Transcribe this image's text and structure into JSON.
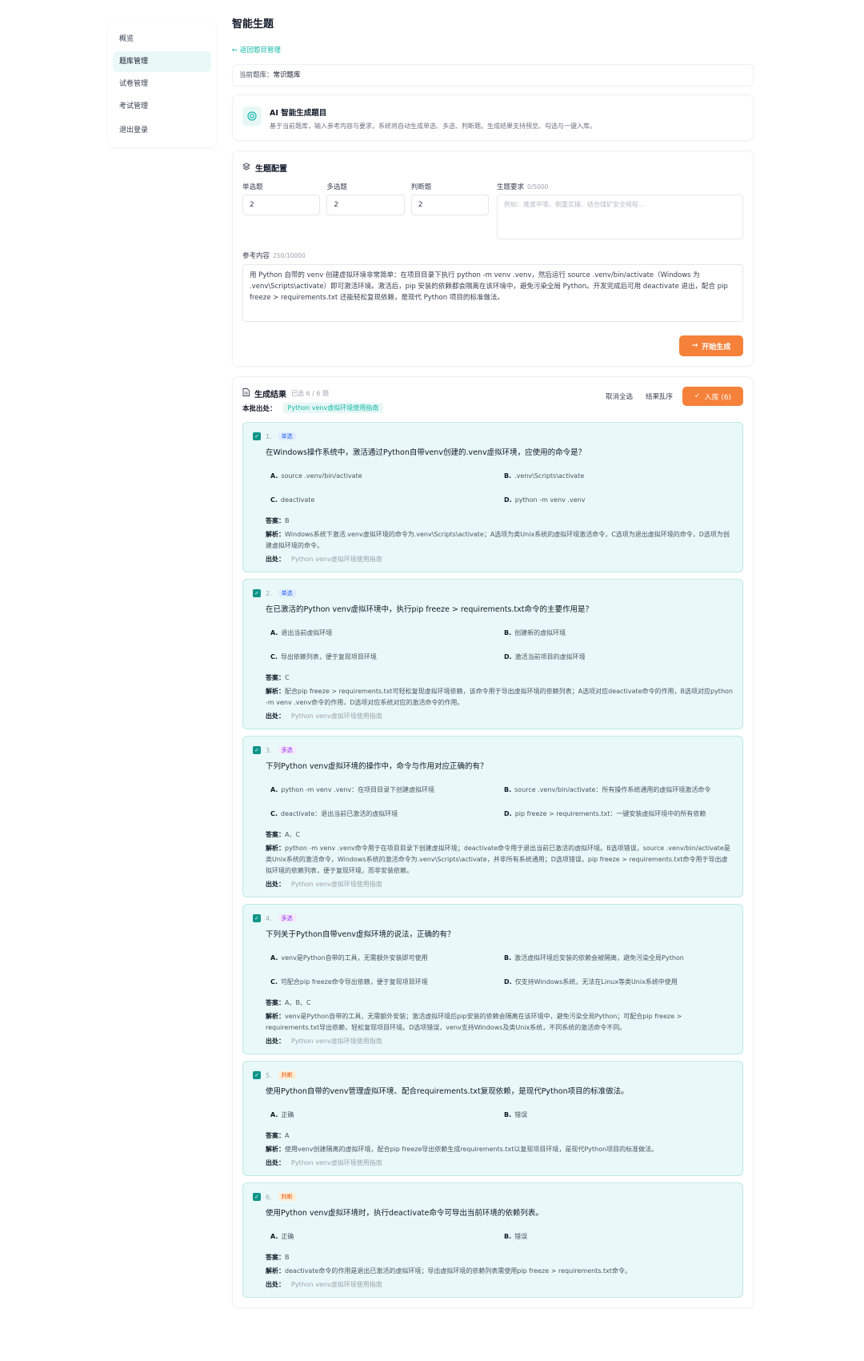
{
  "sidebar": {
    "items": [
      {
        "label": "概览"
      },
      {
        "label": "题库管理"
      },
      {
        "label": "试卷管理"
      },
      {
        "label": "考试管理"
      },
      {
        "label": "退出登录"
      }
    ]
  },
  "header": {
    "title": "智能生题",
    "back": "← 返回题目管理"
  },
  "bank": {
    "label": "当前题库：",
    "value": "常识题库"
  },
  "ai": {
    "title": "AI 智能生成题目",
    "desc": "基于当前题库，输入参考内容与要求，系统将自动生成单选、多选、判断题。生成结果支持预览、勾选与一键入库。"
  },
  "config": {
    "title": "生题配置",
    "single_label": "单选题",
    "single_value": "2",
    "multi_label": "多选题",
    "multi_value": "2",
    "judge_label": "判断题",
    "judge_value": "2",
    "req_label": "生题要求",
    "req_count": "0/5000",
    "req_placeholder": "例如：难度中等、侧重实操、结合煤矿安全规程...",
    "ref_label": "参考内容",
    "ref_count": "250/10000",
    "ref_text": "用 Python 自带的 venv 创建虚拟环境非常简单：在项目目录下执行 python -m venv .venv，然后运行 source .venv/bin/activate（Windows 为 .venv\\Scripts\\activate）即可激活环境。激活后，pip 安装的依赖都会隔离在该环境中，避免污染全局 Python。开发完成后可用 deactivate 退出，配合 pip freeze > requirements.txt 还能轻松复现依赖，是现代 Python 项目的标准做法。",
    "generate_btn": "开始生成"
  },
  "result": {
    "title": "生成结果",
    "selected": "已选 6 / 6 题",
    "source_label": "本批出处：",
    "source_tag": "Python venv虚拟环境使用指南",
    "deselect_all": "取消全选",
    "shuffle": "结果乱序",
    "import_btn": "入库 (6)"
  },
  "questions": [
    {
      "num": "1.",
      "type": "单选",
      "type_class": "single",
      "stem": "在Windows操作系统中，激活通过Python自带venv创建的.venv虚拟环境，应使用的命令是？",
      "options": [
        {
          "key": "A.",
          "text": "source .venv/bin/activate"
        },
        {
          "key": "B.",
          "text": ".venv\\Scripts\\activate"
        },
        {
          "key": "C.",
          "text": "deactivate"
        },
        {
          "key": "D.",
          "text": "python -m venv .venv"
        }
      ],
      "answer_label": "答案：",
      "answer": "B",
      "analysis_label": "解析：",
      "analysis": "Windows系统下激活.venv虚拟环境的命令为.venv\\Scripts\\activate；A选项为类Unix系统的虚拟环境激活命令，C选项为退出虚拟环境的命令，D选项为创建虚拟环境的命令。",
      "source_label": "出处：",
      "source": "Python venv虚拟环境使用指南"
    },
    {
      "num": "2.",
      "type": "单选",
      "type_class": "single",
      "stem": "在已激活的Python venv虚拟环境中，执行pip freeze > requirements.txt命令的主要作用是？",
      "options": [
        {
          "key": "A.",
          "text": "退出当前虚拟环境"
        },
        {
          "key": "B.",
          "text": "创建新的虚拟环境"
        },
        {
          "key": "C.",
          "text": "导出依赖列表，便于复现项目环境"
        },
        {
          "key": "D.",
          "text": "激活当前项目的虚拟环境"
        }
      ],
      "answer_label": "答案：",
      "answer": "C",
      "analysis_label": "解析：",
      "analysis": "配合pip freeze > requirements.txt可轻松复现虚拟环境依赖，该命令用于导出虚拟环境的依赖列表；A选项对应deactivate命令的作用，B选项对应python -m venv .venv命令的作用，D选项对应系统对应的激活命令的作用。",
      "source_label": "出处：",
      "source": "Python venv虚拟环境使用指南"
    },
    {
      "num": "3.",
      "type": "多选",
      "type_class": "multi",
      "stem": "下列Python venv虚拟环境的操作中，命令与作用对应正确的有？",
      "options": [
        {
          "key": "A.",
          "text": "python -m venv .venv：在项目目录下创建虚拟环境"
        },
        {
          "key": "B.",
          "text": "source .venv/bin/activate：所有操作系统通用的虚拟环境激活命令"
        },
        {
          "key": "C.",
          "text": "deactivate：退出当前已激活的虚拟环境"
        },
        {
          "key": "D.",
          "text": "pip freeze > requirements.txt：一键安装虚拟环境中的所有依赖"
        }
      ],
      "answer_label": "答案：",
      "answer": "A、C",
      "analysis_label": "解析：",
      "analysis": "python -m venv .venv命令用于在项目目录下创建虚拟环境；deactivate命令用于退出当前已激活的虚拟环境。B选项错误，source .venv/bin/activate是类Unix系统的激活命令，Windows系统的激活命令为.venv\\Scripts\\activate，并非所有系统通用；D选项错误，pip freeze > requirements.txt命令用于导出虚拟环境的依赖列表，便于复现环境，而非安装依赖。",
      "source_label": "出处：",
      "source": "Python venv虚拟环境使用指南"
    },
    {
      "num": "4.",
      "type": "多选",
      "type_class": "multi",
      "stem": "下列关于Python自带venv虚拟环境的说法，正确的有？",
      "options": [
        {
          "key": "A.",
          "text": "venv是Python自带的工具，无需额外安装即可使用"
        },
        {
          "key": "B.",
          "text": "激活虚拟环境后安装的依赖会被隔离，避免污染全局Python"
        },
        {
          "key": "C.",
          "text": "可配合pip freeze命令导出依赖，便于复现项目环境"
        },
        {
          "key": "D.",
          "text": "仅支持Windows系统，无法在Linux等类Unix系统中使用"
        }
      ],
      "answer_label": "答案：",
      "answer": "A、B、C",
      "analysis_label": "解析：",
      "analysis": "venv是Python自带的工具，无需额外安装；激活虚拟环境后pip安装的依赖会隔离在该环境中，避免污染全局Python；可配合pip freeze > requirements.txt导出依赖，轻松复现项目环境。D选项错误，venv支持Windows及类Unix系统，不同系统的激活命令不同。",
      "source_label": "出处：",
      "source": "Python venv虚拟环境使用指南"
    },
    {
      "num": "5.",
      "type": "判断",
      "type_class": "judge",
      "stem": "使用Python自带的venv管理虚拟环境、配合requirements.txt复现依赖，是现代Python项目的标准做法。",
      "options": [
        {
          "key": "A.",
          "text": "正确"
        },
        {
          "key": "B.",
          "text": "错误"
        }
      ],
      "answer_label": "答案：",
      "answer": "A",
      "analysis_label": "解析：",
      "analysis": "使用venv创建隔离的虚拟环境，配合pip freeze导出依赖生成requirements.txt以复现项目环境，是现代Python项目的标准做法。",
      "source_label": "出处：",
      "source": "Python venv虚拟环境使用指南"
    },
    {
      "num": "6.",
      "type": "判断",
      "type_class": "judge",
      "stem": "使用Python venv虚拟环境时，执行deactivate命令可导出当前环境的依赖列表。",
      "options": [
        {
          "key": "A.",
          "text": "正确"
        },
        {
          "key": "B.",
          "text": "错误"
        }
      ],
      "answer_label": "答案：",
      "answer": "B",
      "analysis_label": "解析：",
      "analysis": "deactivate命令的作用是退出已激活的虚拟环境；导出虚拟环境的依赖列表需使用pip freeze > requirements.txt命令。",
      "source_label": "出处：",
      "source": "Python venv虚拟环境使用指南"
    }
  ],
  "colors": {
    "accent": "#14b8a6",
    "primary_btn": "#f5813a",
    "question_bg": "#e9f8f8"
  }
}
